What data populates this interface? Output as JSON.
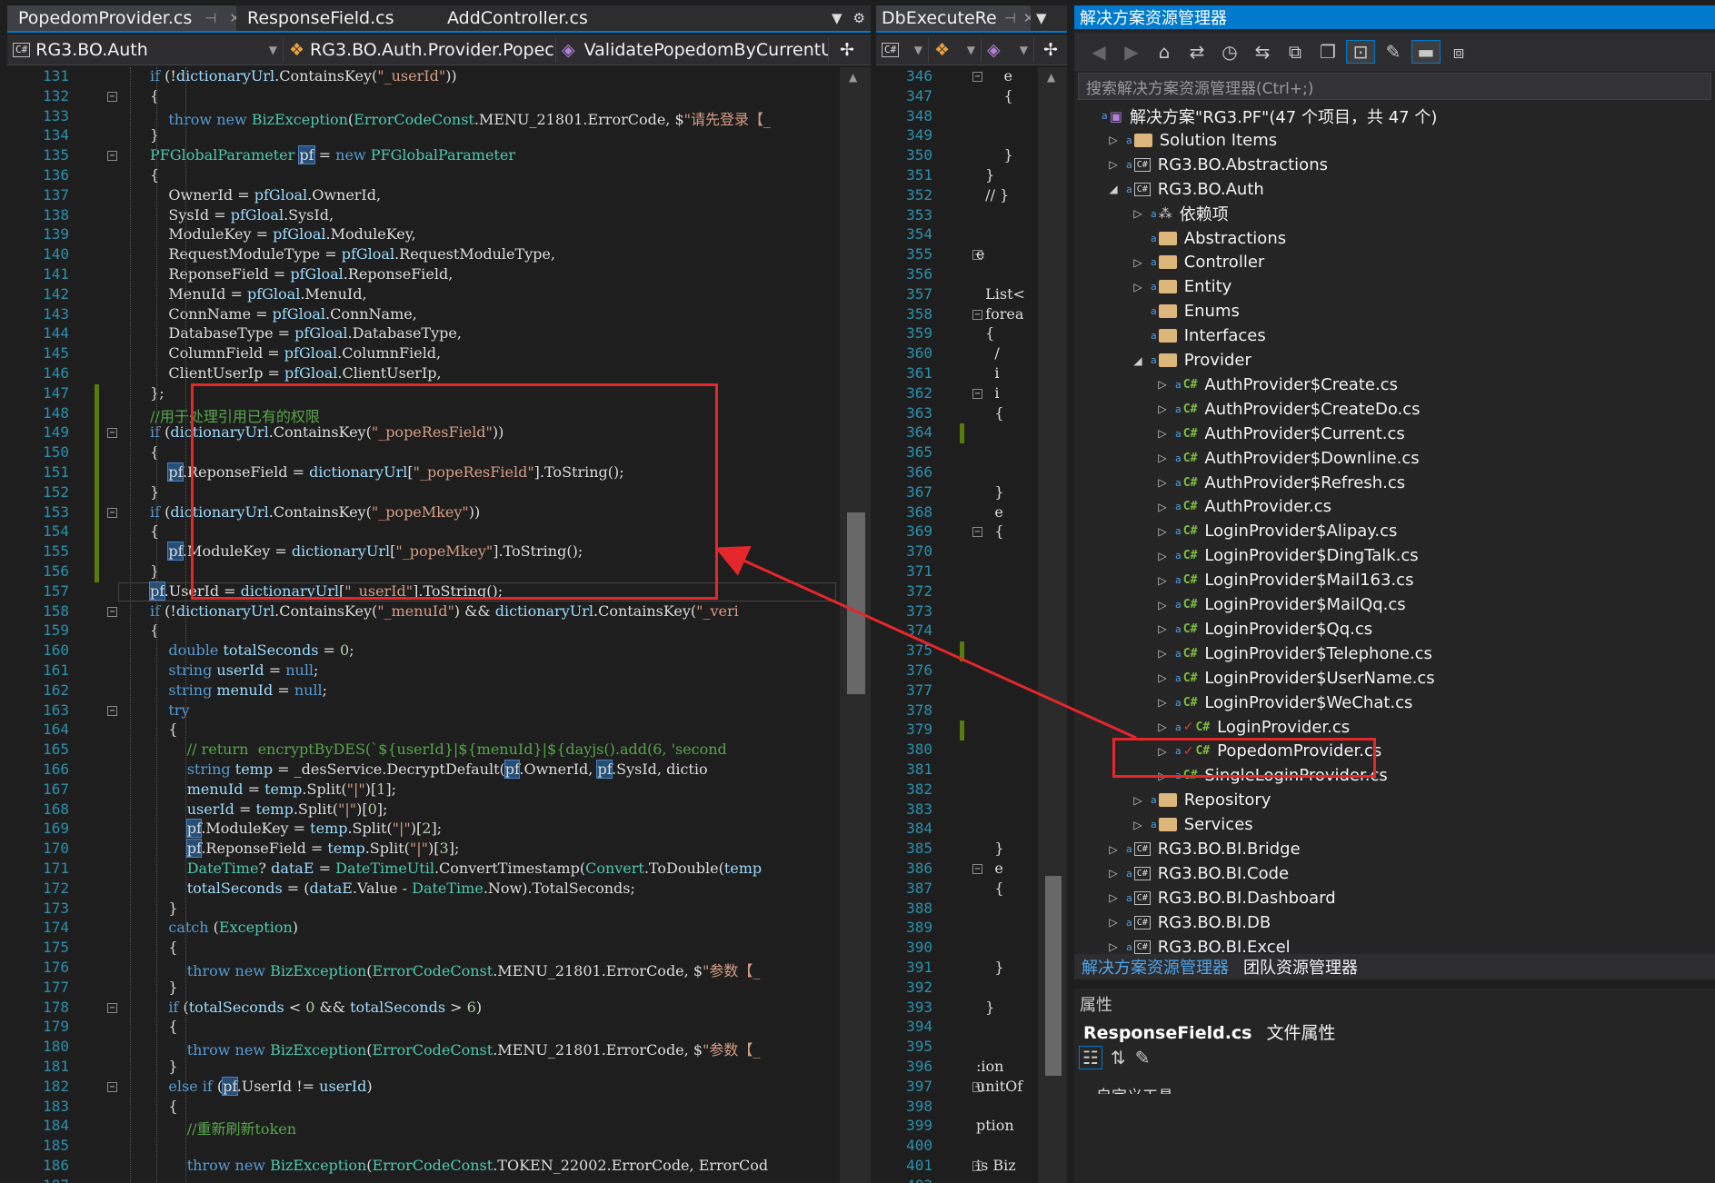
{
  "left_tabs": [
    {
      "label": "PopedomProvider.cs",
      "active": true
    },
    {
      "label": "ResponseField.cs"
    },
    {
      "label": "AddController.cs"
    }
  ],
  "left_nav": {
    "project": "RG3.BO.Auth",
    "class": "RG3.BO.Auth.Provider.Popec",
    "member": "ValidatePopedomByCurrentU"
  },
  "right_tab": {
    "label": "DbExecuteRe"
  },
  "left_editor": {
    "line_numbers": [
      "131",
      "132",
      "133",
      "134",
      "135",
      "136",
      "137",
      "138",
      "139",
      "140",
      "141",
      "142",
      "143",
      "144",
      "145",
      "146",
      "147",
      "148",
      "149",
      "150",
      "151",
      "152",
      "153",
      "154",
      "155",
      "156",
      "157",
      "158",
      "159",
      "160",
      "161",
      "162",
      "163",
      "164",
      "165",
      "166",
      "167",
      "168",
      "169",
      "170",
      "171",
      "172",
      "173",
      "174",
      "175",
      "176",
      "177",
      "178",
      "179",
      "180",
      "181",
      "182",
      "183",
      "184",
      "185",
      "186",
      "187"
    ],
    "lines": [
      "            if (!dictionaryUrl.ContainsKey(\"_userId\"))",
      "            {",
      "                throw new BizException(ErrorCodeConst.MENU_21801.ErrorCode, $\"请先登录【_",
      "            }",
      "            PFGlobalParameter pf = new PFGlobalParameter",
      "            {",
      "                OwnerId = pfGloal.OwnerId,",
      "                SysId = pfGloal.SysId,",
      "                ModuleKey = pfGloal.ModuleKey,",
      "                RequestModuleType = pfGloal.RequestModuleType,",
      "                ReponseField = pfGloal.ReponseField,",
      "                MenuId = pfGloal.MenuId,",
      "                ConnName = pfGloal.ConnName,",
      "                DatabaseType = pfGloal.DatabaseType,",
      "                ColumnField = pfGloal.ColumnField,",
      "                ClientUserIp = pfGloal.ClientUserIp,",
      "            };",
      "            //用于处理引用已有的权限",
      "            if (dictionaryUrl.ContainsKey(\"_popeResField\"))",
      "            {",
      "                pf.ReponseField = dictionaryUrl[\"_popeResField\"].ToString();",
      "            }",
      "            if (dictionaryUrl.ContainsKey(\"_popeMkey\"))",
      "            {",
      "                pf.ModuleKey = dictionaryUrl[\"_popeMkey\"].ToString();",
      "            }",
      "            pf.UserId = dictionaryUrl[\"_userId\"].ToString();",
      "            if (!dictionaryUrl.ContainsKey(\"_menuId\") && dictionaryUrl.ContainsKey(\"_veri",
      "            {",
      "                double totalSeconds = 0;",
      "                string userId = null;",
      "                string menuId = null;",
      "                try",
      "                {",
      "                    // return  encryptByDES(`${userId}|${menuId}|${dayjs().add(6, 'second",
      "                    string temp = _desService.DecryptDefault(pf.OwnerId, pf.SysId, dictio",
      "                    menuId = temp.Split(\"|\")[1];",
      "                    userId = temp.Split(\"|\")[0];",
      "                    pf.ModuleKey = temp.Split(\"|\")[2];",
      "                    pf.ReponseField = temp.Split(\"|\")[3];",
      "                    DateTime? dataE = DateTimeUtil.ConvertTimestamp(Convert.ToDouble(temp",
      "                    totalSeconds = (dataE.Value - DateTime.Now).TotalSeconds;",
      "                }",
      "                catch (Exception)",
      "                {",
      "                    throw new BizException(ErrorCodeConst.MENU_21801.ErrorCode, $\"参数【_",
      "                }",
      "                if (totalSeconds < 0 && totalSeconds > 6)",
      "                {",
      "                    throw new BizException(ErrorCodeConst.MENU_21801.ErrorCode, $\"参数【_",
      "                }",
      "                else if (pf.UserId != userId)",
      "                {",
      "                    //重新刷新token",
      "",
      "                    throw new BizException(ErrorCodeConst.TOKEN_22002.ErrorCode, ErrorCod",
      ""
    ]
  },
  "right_editor": {
    "line_numbers": [
      "346",
      "347",
      "348",
      "349",
      "350",
      "351",
      "352",
      "353",
      "354",
      "355",
      "356",
      "357",
      "358",
      "359",
      "360",
      "361",
      "362",
      "363",
      "364",
      "365",
      "366",
      "367",
      "368",
      "369",
      "370",
      "371",
      "372",
      "373",
      "374",
      "375",
      "376",
      "377",
      "378",
      "379",
      "380",
      "381",
      "382",
      "383",
      "384",
      "385",
      "386",
      "387",
      "388",
      "389",
      "390",
      "391",
      "392",
      "393",
      "394",
      "395",
      "396",
      "397",
      "398",
      "399",
      "400",
      "401",
      "402"
    ],
    "lines": [
      "      e",
      "      {",
      "",
      "",
      "      }",
      "  }",
      "  // }",
      "",
      "",
      "e",
      "",
      "  List<",
      "  forea",
      "  {",
      "    /",
      "    i",
      "    i",
      "    {",
      "",
      "",
      "",
      "    }",
      "    e",
      "    {",
      "",
      "",
      "",
      "",
      "",
      "",
      "",
      "",
      "",
      "",
      "",
      "",
      "",
      "",
      "",
      "    }",
      "    e",
      "    {",
      "",
      "",
      "",
      "    }",
      "",
      "  }",
      "",
      "",
      ":ion",
      "unitOf",
      "",
      "ption",
      "",
      "is Biz",
      ""
    ]
  },
  "solution_explorer": {
    "title": "解决方案资源管理器",
    "search_placeholder": "搜索解决方案资源管理器(Ctrl+;)",
    "rows": [
      {
        "label": "解决方案\"RG3.PF\"(47 个项目，共 47 个)",
        "depth": 0,
        "kind": "solution",
        "expander": ""
      },
      {
        "label": "Solution Items",
        "depth": 1,
        "kind": "folder",
        "expander": "right"
      },
      {
        "label": "RG3.BO.Abstractions",
        "depth": 1,
        "kind": "project",
        "expander": "right"
      },
      {
        "label": "RG3.BO.Auth",
        "depth": 1,
        "kind": "project",
        "expander": "down"
      },
      {
        "label": "依赖项",
        "depth": 2,
        "kind": "deps",
        "expander": "right"
      },
      {
        "label": "Abstractions",
        "depth": 2,
        "kind": "folder",
        "expander": ""
      },
      {
        "label": "Controller",
        "depth": 2,
        "kind": "folder",
        "expander": "right"
      },
      {
        "label": "Entity",
        "depth": 2,
        "kind": "folder",
        "expander": "right"
      },
      {
        "label": "Enums",
        "depth": 2,
        "kind": "folder",
        "expander": ""
      },
      {
        "label": "Interfaces",
        "depth": 2,
        "kind": "folder",
        "expander": ""
      },
      {
        "label": "Provider",
        "depth": 2,
        "kind": "folder-open",
        "expander": "down"
      },
      {
        "label": "AuthProvider$Create.cs",
        "depth": 3,
        "kind": "cs",
        "expander": "right"
      },
      {
        "label": "AuthProvider$CreateDo.cs",
        "depth": 3,
        "kind": "cs",
        "expander": "right"
      },
      {
        "label": "AuthProvider$Current.cs",
        "depth": 3,
        "kind": "cs",
        "expander": "right"
      },
      {
        "label": "AuthProvider$Downline.cs",
        "depth": 3,
        "kind": "cs",
        "expander": "right"
      },
      {
        "label": "AuthProvider$Refresh.cs",
        "depth": 3,
        "kind": "cs",
        "expander": "right"
      },
      {
        "label": "AuthProvider.cs",
        "depth": 3,
        "kind": "cs",
        "expander": "right"
      },
      {
        "label": "LoginProvider$Alipay.cs",
        "depth": 3,
        "kind": "cs",
        "expander": "right"
      },
      {
        "label": "LoginProvider$DingTalk.cs",
        "depth": 3,
        "kind": "cs",
        "expander": "right"
      },
      {
        "label": "LoginProvider$Mail163.cs",
        "depth": 3,
        "kind": "cs",
        "expander": "right"
      },
      {
        "label": "LoginProvider$MailQq.cs",
        "depth": 3,
        "kind": "cs",
        "expander": "right"
      },
      {
        "label": "LoginProvider$Qq.cs",
        "depth": 3,
        "kind": "cs",
        "expander": "right"
      },
      {
        "label": "LoginProvider$Telephone.cs",
        "depth": 3,
        "kind": "cs",
        "expander": "right"
      },
      {
        "label": "LoginProvider$UserName.cs",
        "depth": 3,
        "kind": "cs",
        "expander": "right"
      },
      {
        "label": "LoginProvider$WeChat.cs",
        "depth": 3,
        "kind": "cs",
        "expander": "right"
      },
      {
        "label": "LoginProvider.cs",
        "depth": 3,
        "kind": "cs-checked",
        "expander": "right"
      },
      {
        "label": "PopedomProvider.cs",
        "depth": 3,
        "kind": "cs-checked",
        "expander": "right"
      },
      {
        "label": "SingleLoginProvider.cs",
        "depth": 3,
        "kind": "cs",
        "expander": "right"
      },
      {
        "label": "Repository",
        "depth": 2,
        "kind": "folder",
        "expander": "right"
      },
      {
        "label": "Services",
        "depth": 2,
        "kind": "folder",
        "expander": "right"
      },
      {
        "label": "RG3.BO.BI.Bridge",
        "depth": 1,
        "kind": "project",
        "expander": "right"
      },
      {
        "label": "RG3.BO.BI.Code",
        "depth": 1,
        "kind": "project",
        "expander": "right"
      },
      {
        "label": "RG3.BO.BI.Dashboard",
        "depth": 1,
        "kind": "project",
        "expander": "right"
      },
      {
        "label": "RG3.BO.BI.DB",
        "depth": 1,
        "kind": "project",
        "expander": "right"
      },
      {
        "label": "RG3.BO.BI.Excel",
        "depth": 1,
        "kind": "project",
        "expander": "right"
      }
    ]
  },
  "bottom_tabs": [
    "解决方案资源管理器",
    "团队资源管理器"
  ],
  "properties": {
    "title": "属性",
    "subject": "ResponseField.cs",
    "subject_suffix": "文件属性",
    "section": "自定义工具"
  },
  "colors": {
    "accent": "#007acc",
    "annotation_red": "#e5262b",
    "editor_bg": "#1e1e1e"
  }
}
